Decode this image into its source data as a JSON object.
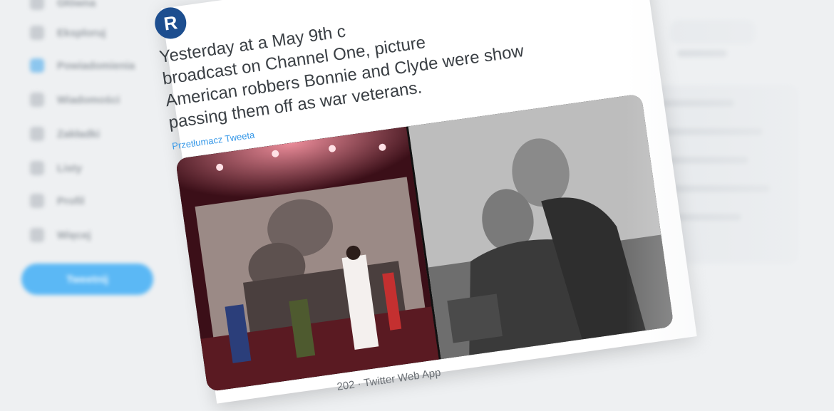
{
  "sidebar": {
    "items": [
      {
        "label": "Główna",
        "icon": "home-icon"
      },
      {
        "label": "Eksploruj",
        "icon": "hashtag-icon"
      },
      {
        "label": "Powiadomienia",
        "icon": "bell-icon"
      },
      {
        "label": "Wiadomości",
        "icon": "mail-icon"
      },
      {
        "label": "Zakładki",
        "icon": "bookmark-icon"
      },
      {
        "label": "Listy",
        "icon": "list-icon"
      },
      {
        "label": "Profil",
        "icon": "user-icon"
      },
      {
        "label": "Więcej",
        "icon": "more-icon"
      }
    ],
    "tweet_button": "Tweetnij"
  },
  "tweet": {
    "avatar_letter": "R",
    "text_lines": [
      "Yesterday at a May 9th c",
      "broadcast on Channel One, picture",
      "American robbers Bonnie and Clyde were show",
      "passing them off as war veterans."
    ],
    "translate_label": "Przetłumacz Tweeta",
    "meta": "202 · Twitter Web App"
  },
  "colors": {
    "accent": "#1d9bf0",
    "avatar_bg": "#1d4e8f",
    "text": "#3a3f44"
  }
}
